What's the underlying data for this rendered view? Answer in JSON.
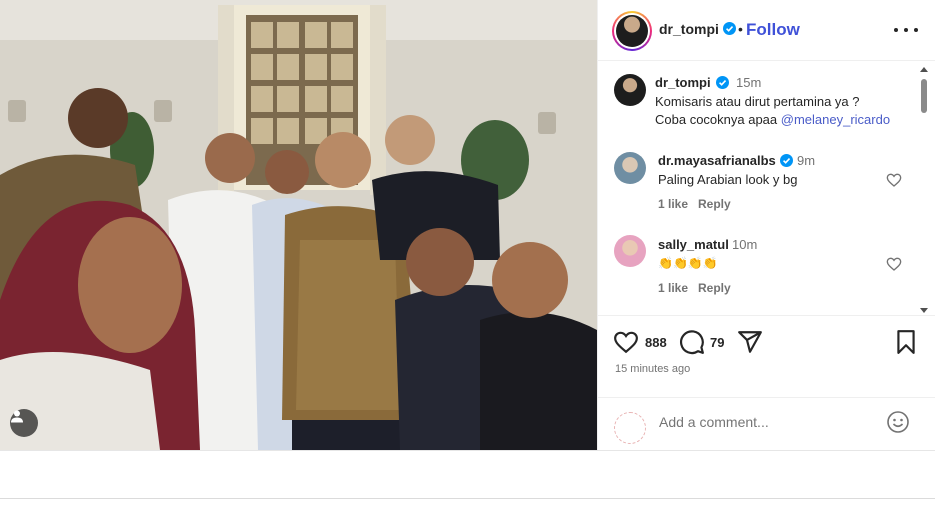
{
  "post": {
    "username": "dr_tompi",
    "separator": "•",
    "follow_label": "Follow",
    "more_label": "More options"
  },
  "caption": {
    "username": "dr_tompi",
    "time": "15m",
    "line1": "Komisaris atau dirut pertamina ya ?",
    "line2_prefix": "Coba cocoknya apaa ",
    "mention": "@melaney_ricardo"
  },
  "comments": [
    {
      "username": "dr.mayasafrianalbs",
      "time": "9m",
      "text": "Paling Arabian look y bg",
      "likes": "1 like",
      "reply": "Reply"
    },
    {
      "username": "sally_matul",
      "time": "10m",
      "text": "👏👏👏👏",
      "likes": "1 like",
      "reply": "Reply"
    }
  ],
  "actions": {
    "likes_count": "888",
    "comments_count": "79",
    "posted_ago": "15 minutes ago"
  },
  "add_comment": {
    "placeholder": "Add a comment..."
  },
  "icons": {
    "verified": "verified-badge-icon",
    "like": "heart-icon",
    "comment": "comment-bubble-icon",
    "share": "paper-plane-icon",
    "save": "bookmark-icon",
    "emoji": "emoji-icon",
    "tag": "user-tag-icon"
  },
  "colors": {
    "follow": "#3f51d8",
    "verified": "#0095f6",
    "link": "#4a5cc8",
    "muted": "#737373"
  }
}
